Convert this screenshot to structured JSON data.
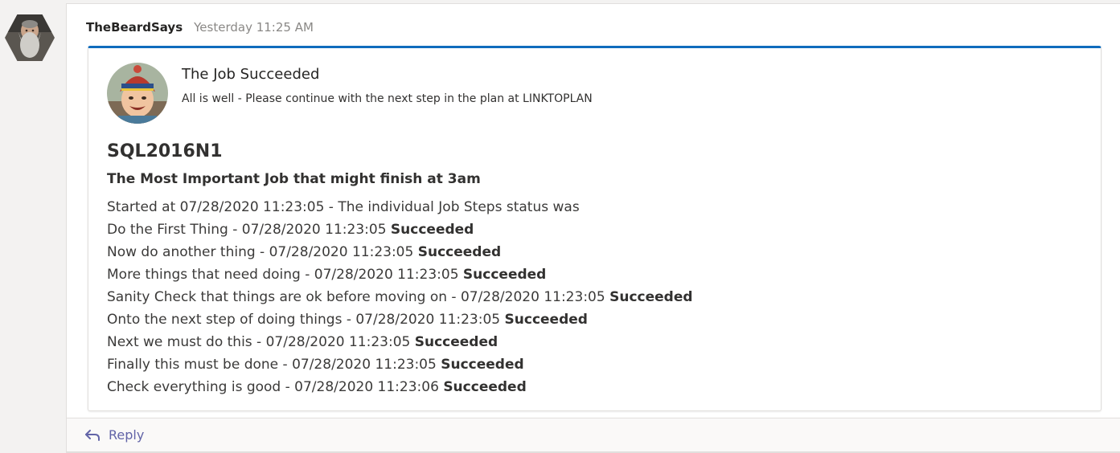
{
  "message": {
    "sender": "TheBeardSays",
    "timestamp": "Yesterday 11:25 AM"
  },
  "card": {
    "title": "The Job Succeeded",
    "subtitle": "All is well - Please continue with the next step in the plan at LINKTOPLAN",
    "server": "SQL2016N1",
    "job_name": "The Most Important Job that might finish at 3am",
    "started_line": "Started at 07/28/2020 11:23:05 - The individual Job Steps status was",
    "steps": [
      {
        "text": "Do the First Thing - 07/28/2020 11:23:05 ",
        "status": "Succeeded"
      },
      {
        "text": "Now do another thing - 07/28/2020 11:23:05 ",
        "status": "Succeeded"
      },
      {
        "text": "More things that need doing - 07/28/2020 11:23:05 ",
        "status": "Succeeded"
      },
      {
        "text": "Sanity Check that things are ok before moving on - 07/28/2020 11:23:05 ",
        "status": "Succeeded"
      },
      {
        "text": "Onto the next step of doing things - 07/28/2020 11:23:05 ",
        "status": "Succeeded"
      },
      {
        "text": "Next we must do this - 07/28/2020 11:23:05 ",
        "status": "Succeeded"
      },
      {
        "text": "Finally this must be done - 07/28/2020 11:23:05 ",
        "status": "Succeeded"
      },
      {
        "text": "Check everything is good - 07/28/2020 11:23:06 ",
        "status": "Succeeded"
      }
    ],
    "accent_color": "#0f6cbd"
  },
  "reply": {
    "label": "Reply",
    "icon": "reply-arrow-icon",
    "color": "#6264a7"
  },
  "icons": {
    "sender_avatar": "bearded-man-avatar",
    "card_thumbnail": "smiling-child-photo"
  }
}
